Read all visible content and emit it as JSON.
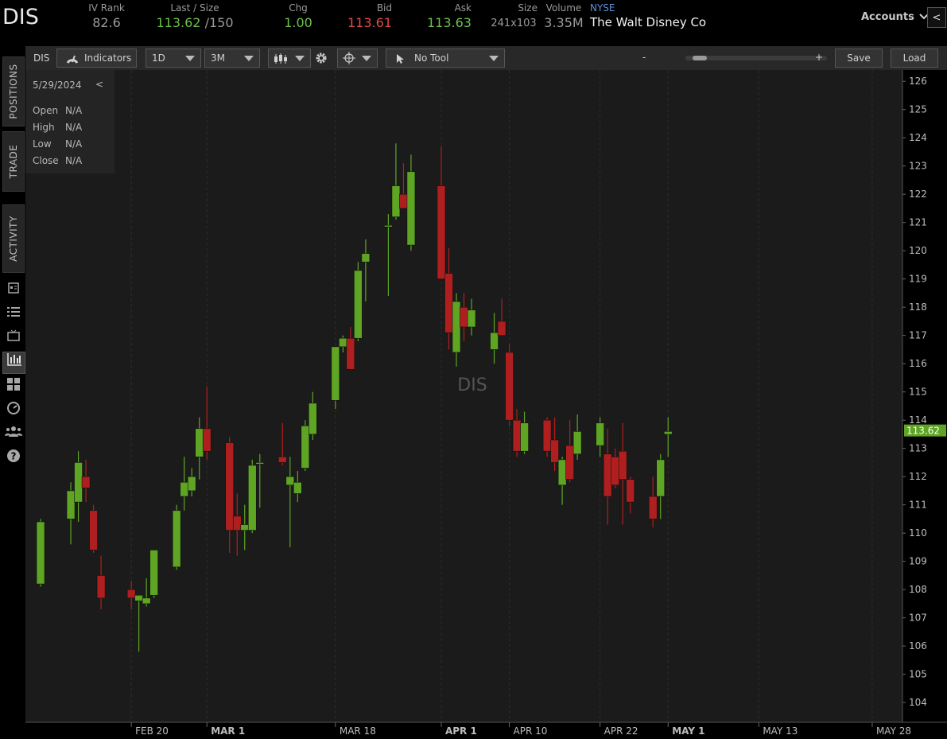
{
  "header": {
    "symbol": "DIS",
    "quotes": [
      {
        "label": "IV Rank",
        "value": "82.6",
        "color": "grey"
      },
      {
        "label": "Last / Size",
        "value": "113.62",
        "value2": " /150",
        "color": "green"
      },
      {
        "label": "Chg",
        "value": "1.00",
        "color": "green"
      },
      {
        "label": "Bid",
        "value": "113.61",
        "color": "red"
      },
      {
        "label": "Ask",
        "value": "113.63",
        "color": "green"
      },
      {
        "label": "Size",
        "value": "241x103",
        "color": "grey"
      },
      {
        "label": "Volume",
        "value": "3.35M",
        "color": "grey"
      }
    ],
    "exchange": "NYSE",
    "company": "The Walt Disney Co",
    "accounts_label": "Accounts",
    "collapse_glyph": "<"
  },
  "sidebar": {
    "tabs": [
      "POSITIONS",
      "TRADE",
      "ACTIVITY"
    ],
    "icons": [
      "news-icon",
      "list-icon",
      "tv-icon",
      "chart-icon",
      "grid-icon",
      "dashboard-icon",
      "community-icon",
      "help-icon"
    ]
  },
  "toolbar": {
    "symbol": "DIS",
    "indicators_label": "Indicators",
    "interval": "1D",
    "range": "3M",
    "tool": "No Tool",
    "zoom_minus": "-",
    "zoom_plus": "+",
    "zoom_level": 0.05,
    "save_label": "Save",
    "load_label": "Load"
  },
  "ohlc_panel": {
    "date": "5/29/2024",
    "back": "<",
    "open_label": "Open",
    "open": "N/A",
    "high_label": "High",
    "high": "N/A",
    "low_label": "Low",
    "low": "N/A",
    "close_label": "Close",
    "close": "N/A"
  },
  "colors": {
    "up": "#5ea524",
    "down": "#b01f1f",
    "price_tag": "#5ea524",
    "background": "#1b1b1b"
  },
  "chart_data": {
    "type": "candlestick",
    "watermark": "DIS",
    "last_price_label": "113.62",
    "ylim": [
      103.3,
      126.4
    ],
    "y_ticks": [
      104,
      105,
      106,
      107,
      108,
      109,
      110,
      111,
      112,
      113,
      114,
      115,
      116,
      117,
      118,
      119,
      120,
      121,
      122,
      123,
      124,
      125,
      126
    ],
    "x_ticks": [
      {
        "label": "FEB 20",
        "bold": false,
        "date": "2024-02-20"
      },
      {
        "label": "MAR 1",
        "bold": true,
        "date": "2024-03-01"
      },
      {
        "label": "MAR 18",
        "bold": false,
        "date": "2024-03-18"
      },
      {
        "label": "APR 1",
        "bold": true,
        "date": "2024-04-01"
      },
      {
        "label": "APR 10",
        "bold": false,
        "date": "2024-04-10"
      },
      {
        "label": "APR 22",
        "bold": false,
        "date": "2024-04-22"
      },
      {
        "label": "MAY 1",
        "bold": true,
        "date": "2024-05-01"
      },
      {
        "label": "MAY 13",
        "bold": false,
        "date": "2024-05-13"
      },
      {
        "label": "MAY 28",
        "bold": false,
        "date": "2024-05-28"
      }
    ],
    "x_range": [
      "2024-02-06",
      "2024-06-01"
    ],
    "candles": [
      {
        "d": "2024-02-08",
        "o": 108.2,
        "h": 110.5,
        "l": 108.1,
        "c": 110.4
      },
      {
        "d": "2024-02-12",
        "o": 110.5,
        "h": 111.8,
        "l": 109.6,
        "c": 111.5
      },
      {
        "d": "2024-02-13",
        "o": 111.1,
        "h": 112.9,
        "l": 110.4,
        "c": 112.5
      },
      {
        "d": "2024-02-14",
        "o": 112.0,
        "h": 112.6,
        "l": 111.1,
        "c": 111.6
      },
      {
        "d": "2024-02-15",
        "o": 110.8,
        "h": 111.0,
        "l": 109.3,
        "c": 109.4
      },
      {
        "d": "2024-02-16",
        "o": 108.5,
        "h": 109.2,
        "l": 107.3,
        "c": 107.7
      },
      {
        "d": "2024-02-20",
        "o": 108.0,
        "h": 108.3,
        "l": 107.3,
        "c": 107.7
      },
      {
        "d": "2024-02-21",
        "o": 107.6,
        "h": 107.8,
        "l": 105.8,
        "c": 107.8
      },
      {
        "d": "2024-02-22",
        "o": 107.5,
        "h": 108.4,
        "l": 107.4,
        "c": 107.7
      },
      {
        "d": "2024-02-23",
        "o": 107.8,
        "h": 109.4,
        "l": 107.7,
        "c": 109.4
      },
      {
        "d": "2024-02-26",
        "o": 108.8,
        "h": 111.0,
        "l": 108.7,
        "c": 110.8
      },
      {
        "d": "2024-02-27",
        "o": 111.3,
        "h": 112.7,
        "l": 110.8,
        "c": 111.8
      },
      {
        "d": "2024-02-28",
        "o": 111.5,
        "h": 112.3,
        "l": 111.3,
        "c": 112.0
      },
      {
        "d": "2024-02-29",
        "o": 112.7,
        "h": 114.1,
        "l": 111.9,
        "c": 113.7
      },
      {
        "d": "2024-03-01",
        "o": 113.7,
        "h": 115.2,
        "l": 112.6,
        "c": 112.9
      },
      {
        "d": "2024-03-04",
        "o": 113.2,
        "h": 113.4,
        "l": 109.3,
        "c": 110.1
      },
      {
        "d": "2024-03-05",
        "o": 110.6,
        "h": 111.4,
        "l": 109.2,
        "c": 110.1
      },
      {
        "d": "2024-03-06",
        "o": 110.1,
        "h": 111.0,
        "l": 109.4,
        "c": 110.3
      },
      {
        "d": "2024-03-07",
        "o": 110.1,
        "h": 112.6,
        "l": 110.0,
        "c": 112.4
      },
      {
        "d": "2024-03-08",
        "o": 112.5,
        "h": 112.8,
        "l": 110.9,
        "c": 112.5
      },
      {
        "d": "2024-03-11",
        "o": 112.7,
        "h": 113.9,
        "l": 112.4,
        "c": 112.5
      },
      {
        "d": "2024-03-12",
        "o": 111.7,
        "h": 112.7,
        "l": 109.5,
        "c": 112.0
      },
      {
        "d": "2024-03-13",
        "o": 111.4,
        "h": 112.2,
        "l": 111.1,
        "c": 111.8
      },
      {
        "d": "2024-03-14",
        "o": 112.3,
        "h": 114.0,
        "l": 112.2,
        "c": 113.8
      },
      {
        "d": "2024-03-15",
        "o": 113.5,
        "h": 115.0,
        "l": 113.3,
        "c": 114.6
      },
      {
        "d": "2024-03-18",
        "o": 114.7,
        "h": 116.5,
        "l": 114.4,
        "c": 116.6
      },
      {
        "d": "2024-03-19",
        "o": 116.6,
        "h": 117.0,
        "l": 116.4,
        "c": 116.9
      },
      {
        "d": "2024-03-20",
        "o": 116.9,
        "h": 117.3,
        "l": 115.8,
        "c": 115.8
      },
      {
        "d": "2024-03-21",
        "o": 116.9,
        "h": 119.6,
        "l": 116.8,
        "c": 119.3
      },
      {
        "d": "2024-03-22",
        "o": 119.6,
        "h": 120.4,
        "l": 118.2,
        "c": 119.9
      },
      {
        "d": "2024-03-25",
        "o": 120.9,
        "h": 121.3,
        "l": 118.4,
        "c": 120.9
      },
      {
        "d": "2024-03-26",
        "o": 121.2,
        "h": 123.8,
        "l": 121.1,
        "c": 122.3
      },
      {
        "d": "2024-03-27",
        "o": 122.0,
        "h": 123.1,
        "l": 121.5,
        "c": 121.5
      },
      {
        "d": "2024-03-28",
        "o": 120.2,
        "h": 123.4,
        "l": 120.0,
        "c": 122.8
      },
      {
        "d": "2024-04-01",
        "o": 122.3,
        "h": 123.7,
        "l": 119.5,
        "c": 119.0
      },
      {
        "d": "2024-04-02",
        "o": 119.2,
        "h": 120.1,
        "l": 116.5,
        "c": 117.1
      },
      {
        "d": "2024-04-03",
        "o": 116.4,
        "h": 118.5,
        "l": 115.9,
        "c": 118.2
      },
      {
        "d": "2024-04-04",
        "o": 118.0,
        "h": 118.5,
        "l": 116.8,
        "c": 117.3
      },
      {
        "d": "2024-04-05",
        "o": 117.3,
        "h": 118.3,
        "l": 117.0,
        "c": 117.9
      },
      {
        "d": "2024-04-08",
        "o": 116.5,
        "h": 117.8,
        "l": 116.0,
        "c": 117.1
      },
      {
        "d": "2024-04-09",
        "o": 117.5,
        "h": 118.3,
        "l": 117.0,
        "c": 117.0
      },
      {
        "d": "2024-04-10",
        "o": 116.4,
        "h": 116.7,
        "l": 113.8,
        "c": 114.0
      },
      {
        "d": "2024-04-11",
        "o": 114.0,
        "h": 114.4,
        "l": 112.7,
        "c": 112.9
      },
      {
        "d": "2024-04-12",
        "o": 112.9,
        "h": 114.3,
        "l": 112.8,
        "c": 113.9
      },
      {
        "d": "2024-04-15",
        "o": 114.0,
        "h": 114.1,
        "l": 112.7,
        "c": 112.9
      },
      {
        "d": "2024-04-16",
        "o": 113.3,
        "h": 114.1,
        "l": 112.2,
        "c": 112.5
      },
      {
        "d": "2024-04-17",
        "o": 111.7,
        "h": 112.7,
        "l": 111.0,
        "c": 112.6
      },
      {
        "d": "2024-04-18",
        "o": 113.1,
        "h": 114.0,
        "l": 111.8,
        "c": 111.9
      },
      {
        "d": "2024-04-19",
        "o": 112.8,
        "h": 114.2,
        "l": 112.6,
        "c": 113.6
      },
      {
        "d": "2024-04-22",
        "o": 113.1,
        "h": 114.1,
        "l": 112.7,
        "c": 113.9
      },
      {
        "d": "2024-04-23",
        "o": 112.8,
        "h": 113.7,
        "l": 110.3,
        "c": 111.3
      },
      {
        "d": "2024-04-24",
        "o": 112.7,
        "h": 113.0,
        "l": 111.6,
        "c": 111.7
      },
      {
        "d": "2024-04-25",
        "o": 112.9,
        "h": 113.9,
        "l": 110.3,
        "c": 111.9
      },
      {
        "d": "2024-04-26",
        "o": 111.9,
        "h": 112.0,
        "l": 110.7,
        "c": 111.1
      },
      {
        "d": "2024-04-29",
        "o": 111.3,
        "h": 112.0,
        "l": 110.2,
        "c": 110.5
      },
      {
        "d": "2024-04-30",
        "o": 111.3,
        "h": 112.8,
        "l": 110.5,
        "c": 112.6
      },
      {
        "d": "2024-05-01",
        "o": 113.5,
        "h": 114.1,
        "l": 112.7,
        "c": 113.6
      }
    ]
  }
}
